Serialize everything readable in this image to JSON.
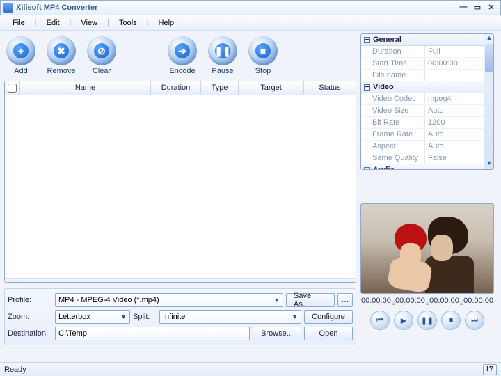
{
  "window": {
    "title": "Xilisoft MP4 Converter"
  },
  "menu": {
    "file": "File",
    "edit": "Edit",
    "view": "View",
    "tools": "Tools",
    "help": "Help"
  },
  "toolbar": {
    "add": "Add",
    "remove": "Remove",
    "clear": "Clear",
    "encode": "Encode",
    "pause": "Pause",
    "stop": "Stop"
  },
  "columns": {
    "name": "Name",
    "duration": "Duration",
    "type": "Type",
    "target": "Target",
    "status": "Status"
  },
  "form": {
    "profile_label": "Profile:",
    "profile_value": "MP4 - MPEG-4 Video (*.mp4)",
    "saveas": "Save As...",
    "zoom_label": "Zoom:",
    "zoom_value": "Letterbox",
    "split_label": "Split:",
    "split_value": "Infinite",
    "configure": "Configure",
    "dest_label": "Destination:",
    "dest_value": "C:\\Temp",
    "browse": "Browse...",
    "open": "Open"
  },
  "status": {
    "text": "Ready",
    "help": "!?"
  },
  "props": {
    "general": "General",
    "g_duration_k": "Duration",
    "g_duration_v": "Full",
    "g_start_k": "Start Time",
    "g_start_v": "00:00:00",
    "g_file_k": "File name",
    "g_file_v": "",
    "video": "Video",
    "v_codec_k": "Video Codec",
    "v_codec_v": "mpeg4",
    "v_size_k": "Video Size",
    "v_size_v": "Auto",
    "v_bitrate_k": "Bit Rate",
    "v_bitrate_v": "1200",
    "v_frame_k": "Frame Rate",
    "v_frame_v": "Auto",
    "v_aspect_k": "Aspect",
    "v_aspect_v": "Auto",
    "v_same_k": "Same Quality",
    "v_same_v": "False",
    "audio": "Audio"
  },
  "timeline": {
    "t0": "00:00:00",
    "t1": "00:00:00",
    "t2": "00:00:00",
    "t3": "00:00:00"
  }
}
